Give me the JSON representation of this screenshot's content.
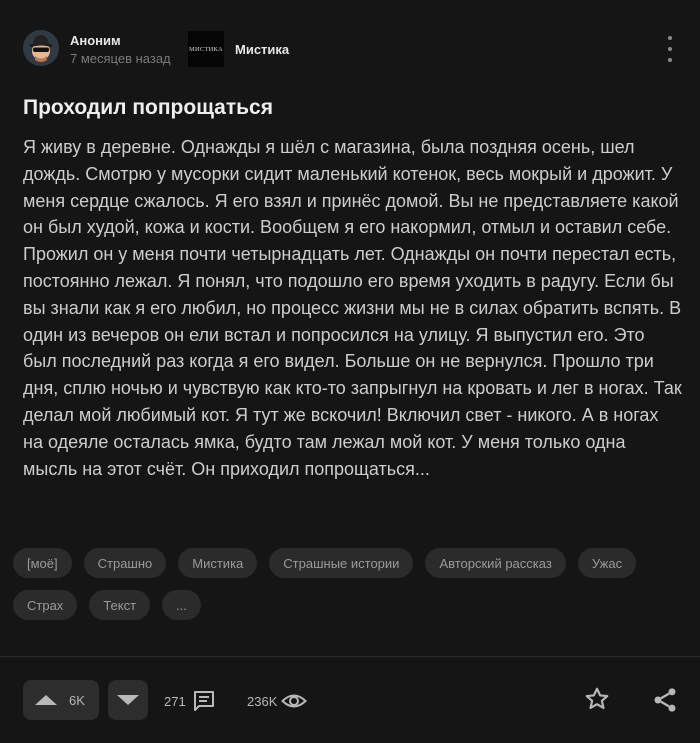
{
  "header": {
    "author_name": "Аноним",
    "post_time": "7 месяцев назад",
    "community_logo_text": "МИСТИКА",
    "community_name": "Мистика"
  },
  "post": {
    "title": "Проходил попрощаться",
    "body": "Я живу в деревне. Однажды я шёл с магазина, была поздняя осень, шел дождь. Смотрю у мусорки сидит маленький котенок, весь мокрый и дрожит. У меня сердце сжалось. Я его взял и принёс домой. Вы не представляете какой он был худой, кожа и кости. Вообщем я его накормил, отмыл и оставил себе. Прожил он у меня почти четырнадцать лет. Однажды он почти перестал есть, постоянно лежал. Я понял, что подошло его время уходить в радугу. Если бы вы знали как я его любил, но процесс жизни мы не в силах обратить вспять. В один из вечеров он ели встал и попросился на улицу. Я выпустил его. Это был последний раз когда я его видел. Больше он не вернулся. Прошло три дня, сплю ночью и чувствую как кто-то запрыгнул на кровать и лег в ногах. Так делал мой любимый кот. Я тут же вскочил! Включил свет - никого. А в ногах на одеяле осталась ямка, будто там лежал мой кот. У меня только одна мысль на этот счёт. Он приходил попрощаться..."
  },
  "tags": {
    "row1": [
      "[моё]",
      "Страшно",
      "Мистика",
      "Страшные истории",
      "Авторский рассказ",
      "Ужас"
    ],
    "row2": [
      "Страх",
      "Текст",
      "..."
    ]
  },
  "actions": {
    "upvotes": "6K",
    "comments": "271",
    "views": "236K"
  },
  "icons": {
    "avatar": "anonymous-avatar-icon",
    "more": "more-vertical-icon",
    "upvote": "triangle-up-icon",
    "downvote": "triangle-down-icon",
    "comments": "comment-icon",
    "views": "eye-icon",
    "save": "star-icon",
    "share": "share-icon"
  },
  "colors": {
    "background": "#151515",
    "tag_background": "#2b2b2b",
    "button_background": "#2d2d2d",
    "text": "#cdcdcd",
    "muted": "#7a7a7a"
  }
}
